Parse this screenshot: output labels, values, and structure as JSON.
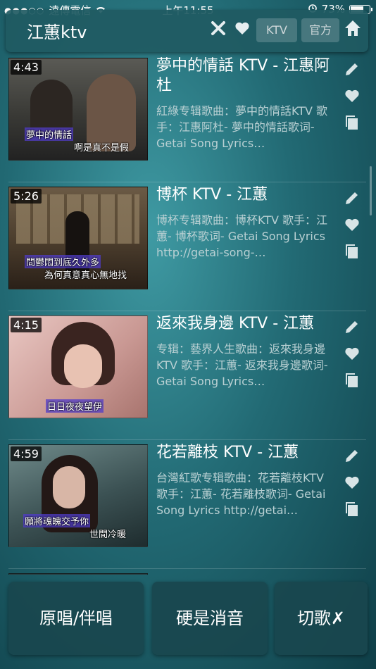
{
  "status": {
    "carrier": "遠傳電信",
    "time": "上午11:55",
    "battery": "73%",
    "battery_level": 0.73
  },
  "header": {
    "title": "江蕙ktv",
    "ktv_label": "KTV",
    "official_label": "官方"
  },
  "songs": [
    {
      "duration": "4:43",
      "title": "夢中的情話 KTV - 江惠阿杜",
      "description": "紅綠专辑歌曲：夢中的情話KTV 歌手：江惠阿杜- 夢中的情話歌词- Getai Song Lyrics…",
      "lyric_a": "夢中的情話",
      "lyric_b": "啊是真不是假"
    },
    {
      "duration": "5:26",
      "title": "博杯 KTV - 江蕙",
      "description": "博杯专辑歌曲：博杯KTV 歌手：江蕙- 博杯歌词- Getai Song Lyrics http://getai-song-…",
      "lyric_a": "問鬱悶到底久外多",
      "lyric_b": "為何真意真心無地找"
    },
    {
      "duration": "4:15",
      "title": "返來我身邊 KTV - 江蕙",
      "description": "专辑：藝界人生歌曲：返來我身邊KTV 歌手：江蕙- 返來我身邊歌词- Getai Song Lyrics…",
      "lyric_a": "日日夜夜望伊",
      "lyric_b": ""
    },
    {
      "duration": "4:59",
      "title": "花若離枝 KTV - 江蕙",
      "description": "台灣紅歌专辑歌曲：花若離枝KTV 歌手：江蕙- 花若離枝歌词- Getai Song Lyrics http://getai…",
      "lyric_a": "願將魂魄交予你",
      "lyric_b": "世間冷暖"
    }
  ],
  "bottom": {
    "original_label": "原唱/伴唱",
    "mute_label": "硬是消音",
    "skip_label": "切歌✗"
  },
  "colors": {
    "background": "#226a74",
    "header": "#205a62",
    "button": "#19464e"
  }
}
